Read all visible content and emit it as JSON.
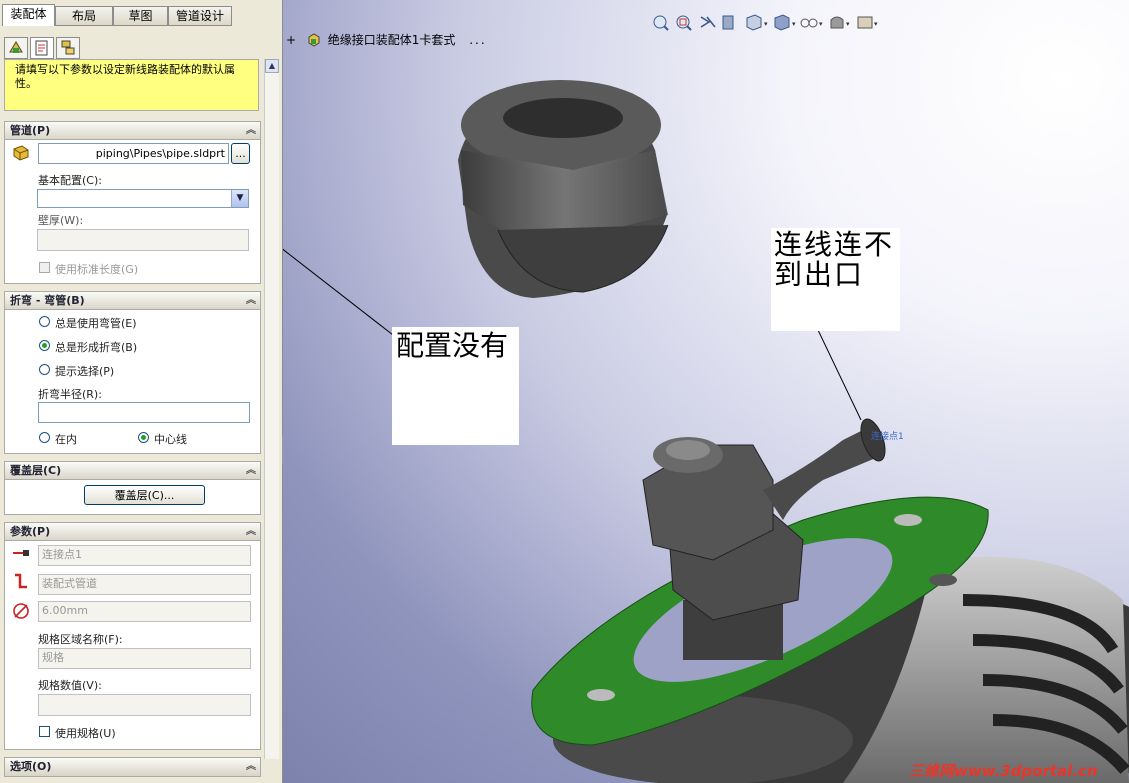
{
  "tabs": [
    {
      "label": "装配体"
    },
    {
      "label": "布局"
    },
    {
      "label": "草图"
    },
    {
      "label": "管道设计"
    }
  ],
  "info_message": "请填写以下参数以设定新线路装配体的默认属性。",
  "pipe_section": {
    "title": "管道(P)",
    "pipe_file": "piping\\Pipes\\pipe.sldprt",
    "browse_label": "...",
    "base_config_label": "基本配置(C):",
    "base_config_value": "",
    "wall_thickness_label": "壁厚(W):",
    "wall_thickness_value": "",
    "standard_length_label": "使用标准长度(G)"
  },
  "bend_section": {
    "title": "折弯 - 弯管(B)",
    "options": [
      "总是使用弯管(E)",
      "总是形成折弯(B)",
      "提示选择(P)"
    ],
    "selected": 1,
    "radius_label": "折弯半径(R):",
    "radius_value": "",
    "inside_label": "在内",
    "centerline_label": "中心线"
  },
  "covering_section": {
    "title": "覆盖层(C)",
    "button_label": "覆盖层(C)..."
  },
  "params_section": {
    "title": "参数(P)",
    "connection_point": "连接点1",
    "route_type": "装配式管道",
    "diameter": "6.00mm",
    "spec_region_label": "规格区域名称(F):",
    "spec_region_value": "规格",
    "spec_value_label": "规格数值(V):",
    "spec_value_value": "",
    "use_spec_label": "使用规格(U)"
  },
  "options_section": {
    "title": "选项(O)"
  },
  "tree": {
    "expand": "+",
    "name": "绝缘接口装配体1卡套式",
    "suffix": "..."
  },
  "annotations": {
    "config": "配置没有",
    "connect": "连线连不到出口",
    "connection_point_label": "连接点1"
  },
  "watermark": "三维网www.3dportal.cn",
  "colors": {
    "flange": "#2f8a2a",
    "nut": "#555555",
    "info_bg": "#ffff80",
    "watermark": "#e8372a"
  }
}
